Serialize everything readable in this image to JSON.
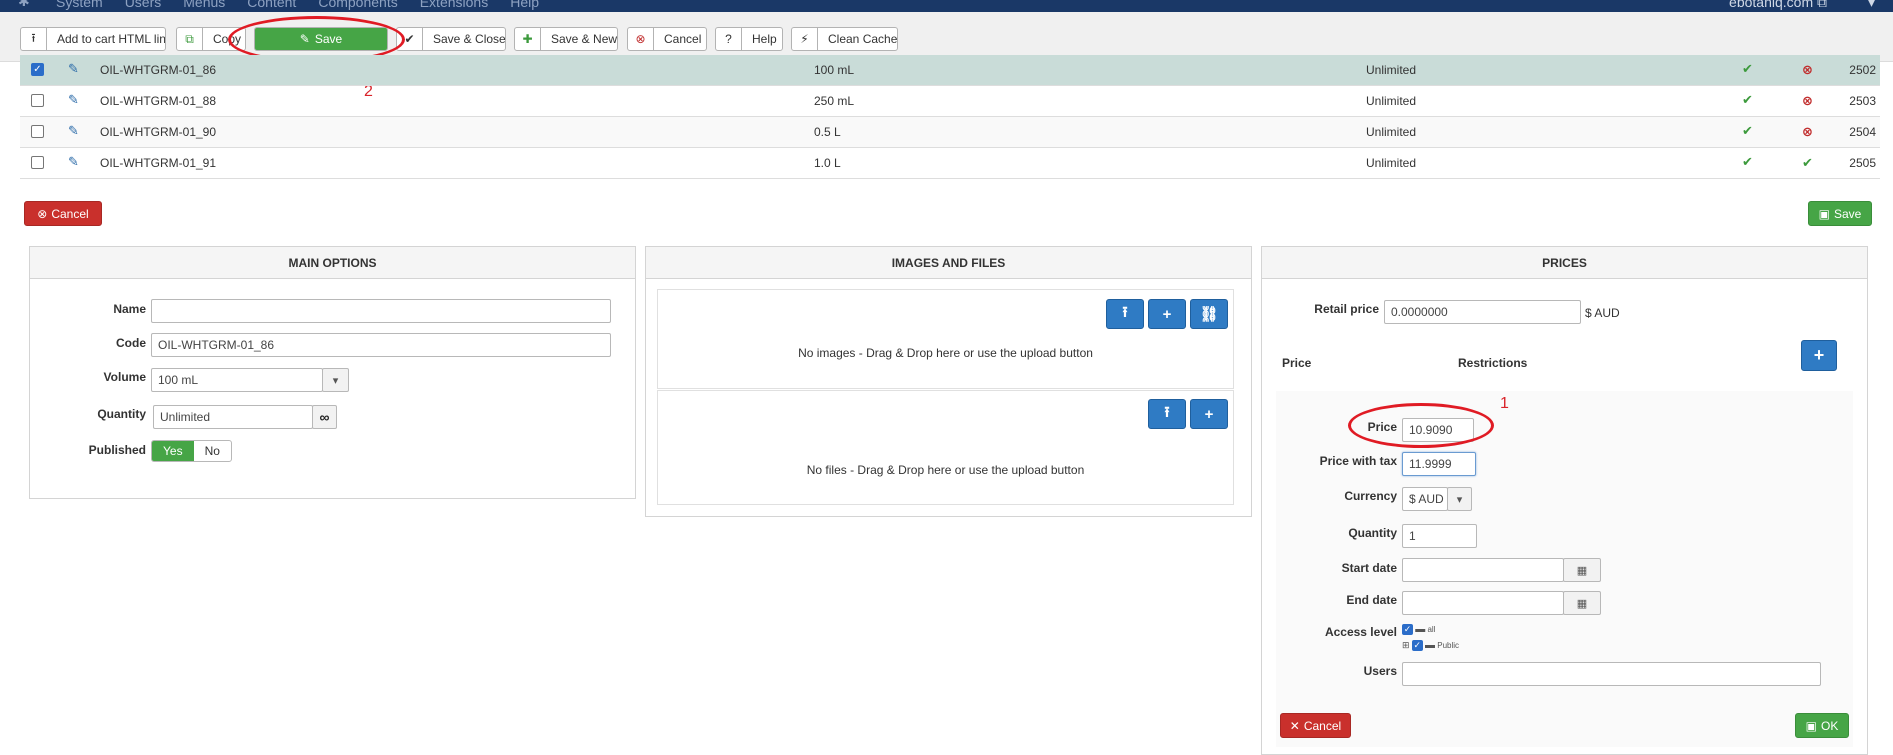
{
  "topnav": {
    "menu": [
      "System",
      "Users",
      "Menus",
      "Content",
      "Components",
      "Extensions",
      "Help"
    ],
    "user": "ebotaniq.com ⧉"
  },
  "toolbar": {
    "add_to_cart": "Add to cart HTML link",
    "copy": "Copy",
    "save": "Save",
    "save_close": "Save & Close",
    "save_new": "Save & New",
    "cancel": "Cancel",
    "help": "Help",
    "clean_cache": "Clean Cache"
  },
  "annotations": {
    "one": "1",
    "two": "2"
  },
  "rows": [
    {
      "code": "OIL-WHTGRM-01_86",
      "volume": "100 mL",
      "quantity": "Unlimited",
      "id": "2502",
      "checked": true,
      "published": false
    },
    {
      "code": "OIL-WHTGRM-01_88",
      "volume": "250 mL",
      "quantity": "Unlimited",
      "id": "2503",
      "checked": false,
      "published": false
    },
    {
      "code": "OIL-WHTGRM-01_90",
      "volume": "0.5 L",
      "quantity": "Unlimited",
      "id": "2504",
      "checked": false,
      "published": false
    },
    {
      "code": "OIL-WHTGRM-01_91",
      "volume": "1.0 L",
      "quantity": "Unlimited",
      "id": "2505",
      "checked": false,
      "published": true
    }
  ],
  "actions": {
    "cancel": "Cancel",
    "save": "Save"
  },
  "main_options": {
    "title": "MAIN OPTIONS",
    "name_label": "Name",
    "name_value": "",
    "code_label": "Code",
    "code_value": "OIL-WHTGRM-01_86",
    "volume_label": "Volume",
    "volume_value": "100 mL",
    "quantity_label": "Quantity",
    "quantity_value": "Unlimited",
    "published_label": "Published",
    "yes": "Yes",
    "no": "No"
  },
  "images_files": {
    "title": "IMAGES AND FILES",
    "no_images": "No images - Drag & Drop here or use the upload button",
    "no_files": "No files - Drag & Drop here or use the upload button"
  },
  "prices": {
    "title": "PRICES",
    "retail_label": "Retail price",
    "retail_value": "0.0000000",
    "currency_suffix": "$ AUD",
    "col_price": "Price",
    "col_restrictions": "Restrictions",
    "price_label": "Price",
    "price_value": "10.9090",
    "price_tax_label": "Price with tax",
    "price_tax_value": "11.9999",
    "currency_label": "Currency",
    "currency_value": "$ AUD",
    "quantity_label": "Quantity",
    "quantity_value": "1",
    "start_label": "Start date",
    "end_label": "End date",
    "access_label": "Access level",
    "access_all": "all",
    "access_public": "Public",
    "users_label": "Users",
    "cancel": "Cancel",
    "ok": "OK"
  }
}
